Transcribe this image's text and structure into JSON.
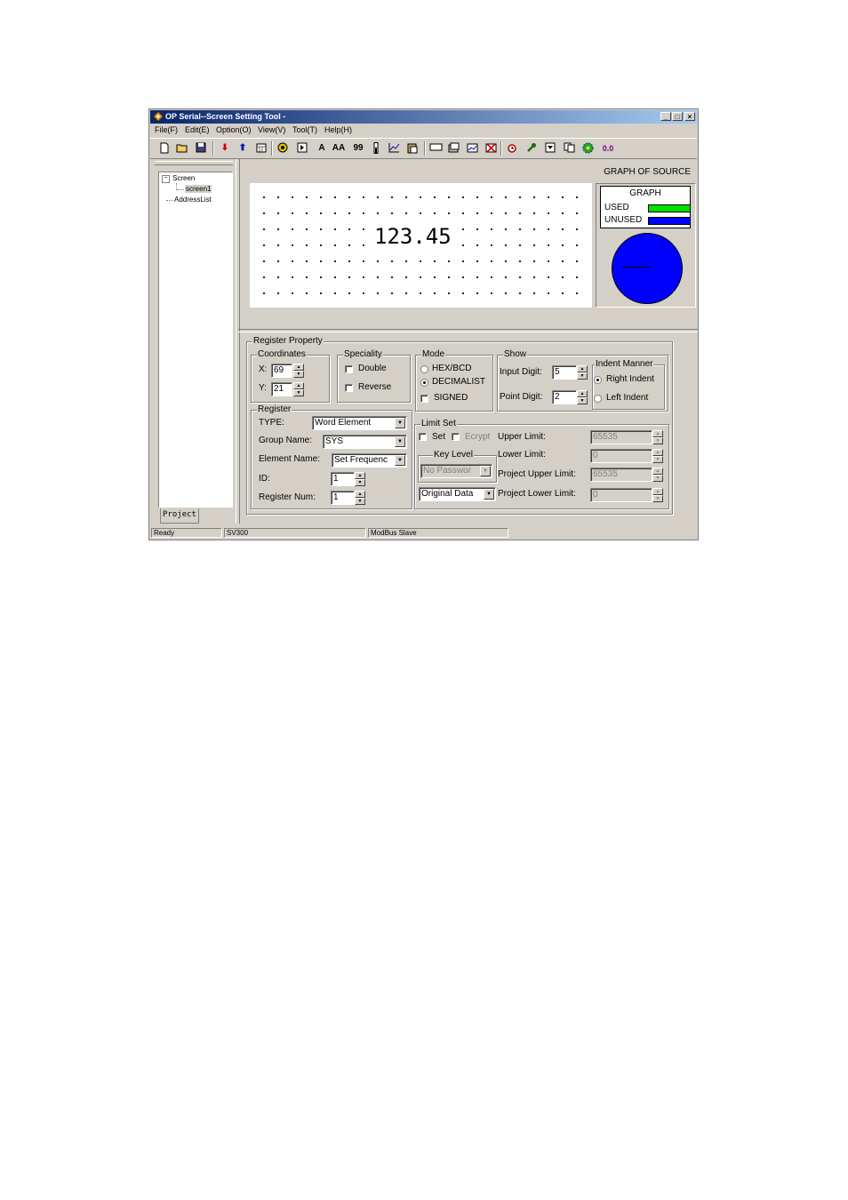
{
  "window": {
    "title": "OP Serial--Screen Setting Tool -",
    "controls": {
      "minimize": "_",
      "maximize": "□",
      "close": "×"
    }
  },
  "menu": [
    "File(F)",
    "Edit(E)",
    "Option(O)",
    "View(V)",
    "Tool(T)",
    "Help(H)"
  ],
  "toolbar": {
    "text_a": "A",
    "text_aa": "AA",
    "text_99": "99",
    "text_00": "0.0",
    "icons": [
      "new-file-icon",
      "open-folder-icon",
      "save-icon",
      "download-arrow-icon",
      "upload-arrow-icon",
      "calendar-icon",
      "circle-target-icon",
      "play-box-icon",
      "text-a-icon",
      "text-aa-icon",
      "number-99-icon",
      "thermometer-icon",
      "line-graph-icon",
      "paste-icon",
      "rectangle-icon",
      "image-icon",
      "bitmap-icon",
      "delete-icon",
      "alarm-clock-icon",
      "wrench-icon",
      "dropdown-icon",
      "copy-icon",
      "gear-icon",
      "decimal-icon"
    ],
    "accent_red": "#d40000",
    "accent_blue": "#0000b0",
    "accent_purple": "#800080"
  },
  "tree": {
    "root": "Screen",
    "child": "screen1",
    "sibling": "AddressList",
    "tab": "Project"
  },
  "preview": {
    "label": "GRAPH OF SOURCE",
    "value": "123.45"
  },
  "graph": {
    "title": "GRAPH",
    "used_label": "USED",
    "unused_label": "UNUSED",
    "used_color": "#00e000",
    "unused_color": "#0000ff"
  },
  "register_property": {
    "title": "Register Property",
    "coordinates": {
      "title": "Coordinates",
      "x_label": "X:",
      "x_value": "69",
      "y_label": "Y:",
      "y_value": "21"
    },
    "speciality": {
      "title": "Speciality",
      "double": "Double",
      "reverse": "Reverse"
    },
    "mode": {
      "title": "Mode",
      "hex": "HEX/BCD",
      "decimal": "DECIMALIST",
      "signed": "SIGNED"
    },
    "show": {
      "title": "Show",
      "input_digit_label": "Input Digit:",
      "input_digit": "5",
      "point_digit_label": "Point Digit:",
      "point_digit": "2"
    },
    "indent": {
      "title": "Indent Manner",
      "right": "Right Indent",
      "left": "Left Indent"
    },
    "register": {
      "title": "Register",
      "type_label": "TYPE:",
      "type_value": "Word Element",
      "group_label": "Group Name:",
      "group_value": "SYS",
      "element_label": "Element Name:",
      "element_value": "Set Frequenc",
      "id_label": "ID:",
      "id_value": "1",
      "num_label": "Register Num:",
      "num_value": "1"
    },
    "limit": {
      "title": "Limit Set",
      "set": "Set",
      "ecrypt": "Ecrypt",
      "key_level": "Key Level",
      "key_value": "No Passwor",
      "data_value": "Original Data",
      "upper_label": "Upper Limit:",
      "upper_value": "65535",
      "lower_label": "Lower Limit:",
      "lower_value": "0",
      "proj_upper_label": "Project Upper Limit:",
      "proj_upper_value": "65535",
      "proj_lower_label": "Project Lower Limit:",
      "proj_lower_value": "0"
    }
  },
  "status": {
    "ready": "Ready",
    "model": "SV300",
    "protocol": "ModBus Slave"
  }
}
